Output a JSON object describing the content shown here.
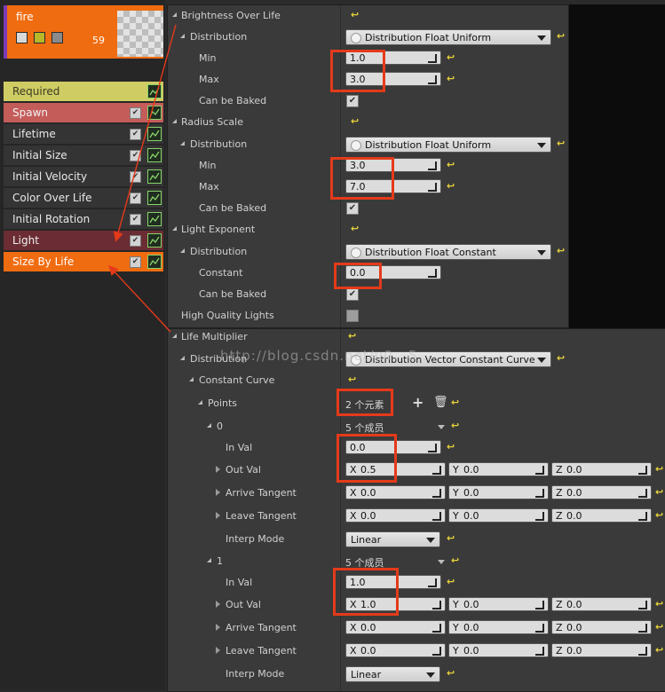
{
  "emitter": {
    "name": "fire",
    "count": "59"
  },
  "modules": [
    {
      "label": "Required",
      "bg": "#cfcc64",
      "color": "#3b3b24"
    },
    {
      "label": "Spawn",
      "bg": "#c45c5a",
      "color": "#f2f2f2"
    },
    {
      "label": "Lifetime",
      "bg": "#343434",
      "color": "#e8e8e8"
    },
    {
      "label": "Initial Size",
      "bg": "#343434",
      "color": "#e8e8e8"
    },
    {
      "label": "Initial Velocity",
      "bg": "#343434",
      "color": "#e8e8e8"
    },
    {
      "label": "Color Over Life",
      "bg": "#343434",
      "color": "#e8e8e8"
    },
    {
      "label": "Initial Rotation",
      "bg": "#343434",
      "color": "#e8e8e8"
    },
    {
      "label": "Light",
      "bg": "#6b2d33",
      "color": "#f0f0f0"
    },
    {
      "label": "Size By Life",
      "bg": "#f06c11",
      "color": "#ffffff"
    }
  ],
  "panel1": {
    "brightness": {
      "label": "Brightness Over Life",
      "distribution_label": "Distribution",
      "distribution_value": "Distribution Float Uniform",
      "min_label": "Min",
      "min_value": "1.0",
      "max_label": "Max",
      "max_value": "3.0",
      "baked_label": "Can be Baked"
    },
    "radius": {
      "label": "Radius Scale",
      "distribution_label": "Distribution",
      "distribution_value": "Distribution Float Uniform",
      "min_label": "Min",
      "min_value": "3.0",
      "max_label": "Max",
      "max_value": "7.0",
      "baked_label": "Can be Baked"
    },
    "exponent": {
      "label": "Light Exponent",
      "distribution_label": "Distribution",
      "distribution_value": "Distribution Float Constant",
      "constant_label": "Constant",
      "constant_value": "0.0",
      "baked_label": "Can be Baked"
    },
    "hq_label": "High Quality Lights"
  },
  "panel2": {
    "life_label": "Life Multiplier",
    "distribution_label": "Distribution",
    "distribution_value": "Distribution Vector Constant Curve",
    "curve_label": "Constant Curve",
    "points_label": "Points",
    "points_value": "2 个元素",
    "point0": {
      "index": "0",
      "members": "5 个成员",
      "inval_label": "In Val",
      "inval": "0.0",
      "outval_label": "Out Val",
      "out_x": "0.5",
      "out_y": "0.0",
      "out_z": "0.0",
      "arrive_label": "Arrive Tangent",
      "arr_x": "0.0",
      "arr_y": "0.0",
      "arr_z": "0.0",
      "leave_label": "Leave Tangent",
      "lea_x": "0.0",
      "lea_y": "0.0",
      "lea_z": "0.0",
      "interp_label": "Interp Mode",
      "interp_value": "Linear"
    },
    "point1": {
      "index": "1",
      "members": "5 个成员",
      "inval_label": "In Val",
      "inval": "1.0",
      "outval_label": "Out Val",
      "out_x": "1.0",
      "out_y": "0.0",
      "out_z": "0.0",
      "arrive_label": "Arrive Tangent",
      "arr_x": "0.0",
      "arr_y": "0.0",
      "arr_z": "0.0",
      "leave_label": "Leave Tangent",
      "lea_x": "0.0",
      "lea_y": "0.0",
      "lea_z": "0.0",
      "interp_label": "Interp Mode",
      "interp_value": "Linear"
    }
  },
  "axis": {
    "x": "X",
    "y": "Y",
    "z": "Z"
  },
  "watermark": "http://blog.csdn.net/u0...5...",
  "icons": {
    "reset": "reset-arrow-icon",
    "add": "plus-icon",
    "delete": "trash-icon"
  },
  "colors": {
    "highlight": "#e53a1a",
    "reset_arrow": "#e8d33a",
    "emitter": "#f06c11"
  }
}
